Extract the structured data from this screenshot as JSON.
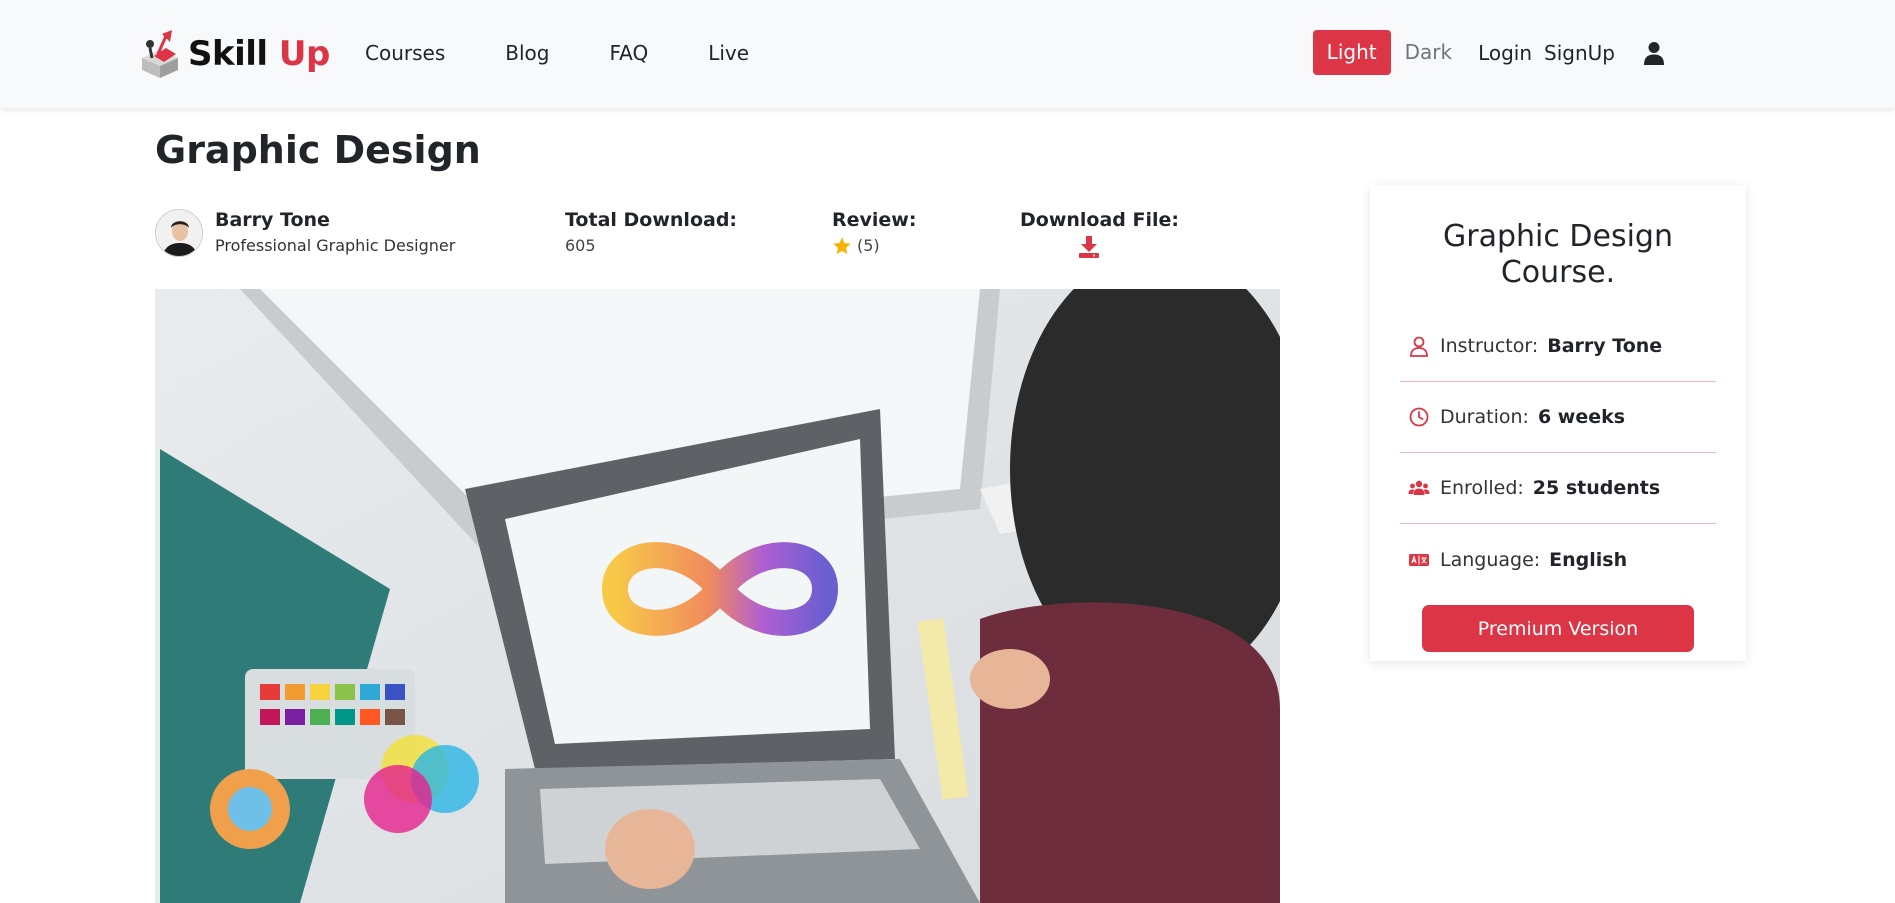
{
  "navbar": {
    "brand_skill": "Skill",
    "brand_up": "Up",
    "links": [
      "Courses",
      "Blog",
      "FAQ",
      "Live"
    ],
    "theme_light": "Light",
    "theme_dark": "Dark",
    "login": "Login",
    "signup": "SignUp",
    "user_icon": "user-icon"
  },
  "course": {
    "title": "Graphic Design",
    "instructor_name": "Barry Tone",
    "instructor_role": "Professional Graphic Designer",
    "total_download_label": "Total Download:",
    "total_download_value": "605",
    "review_label": "Review:",
    "review_value": "(5)",
    "download_file_label": "Download File:"
  },
  "sidebar": {
    "title": "Graphic Design Course.",
    "rows": [
      {
        "icon": "user-icon",
        "label": "Instructor:",
        "value": "Barry Tone"
      },
      {
        "icon": "clock-icon",
        "label": "Duration:",
        "value": "6 weeks"
      },
      {
        "icon": "users-icon",
        "label": "Enrolled:",
        "value": "25 students"
      },
      {
        "icon": "language-icon",
        "label": "Language:",
        "value": "English"
      }
    ],
    "button": "Premium Version"
  },
  "colors": {
    "accent": "#dc3545",
    "navbar_bg": "#f8f9fa",
    "star": "#f5b301"
  }
}
